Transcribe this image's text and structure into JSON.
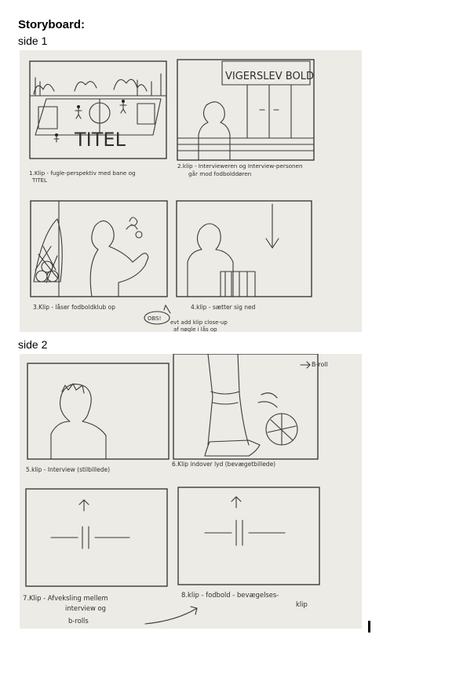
{
  "document": {
    "title": "Storyboard:",
    "sides": [
      {
        "label": "side 1",
        "panels": [
          {
            "caption_line1": "1.Klip - fugle-perspektiv med bane og",
            "caption_line2": "TITEL",
            "drawn_text": "TITEL"
          },
          {
            "caption_line1": "2.klip - Intervieweren og Interview-personen",
            "caption_line2": "går mod fodbolddøren",
            "drawn_text": "VIGERSLEV BOLD"
          },
          {
            "caption_line1": "3.Klip - låser fodboldklub op",
            "caption_line2": ""
          },
          {
            "caption_line1": "4.klip - sætter sig ned",
            "caption_line2": ""
          }
        ],
        "note": {
          "badge": "OBS!",
          "line1": "evt add klip close-up",
          "line2": "af nøgle i lås op"
        }
      },
      {
        "label": "side 2",
        "panels": [
          {
            "caption_line1": "5.klip - Interview (stilbillede)",
            "caption_line2": ""
          },
          {
            "caption_line1": "6.Klip indover lyd (bevægetbillede)",
            "caption_line2": "",
            "drawn_text": "B-roll"
          },
          {
            "caption_line1": "7.Klip - Afveksling mellem",
            "caption_line2": "interview og",
            "caption_line3": "b-rolls"
          },
          {
            "caption_line1": "8.klip - fodbold - bevægelses-",
            "caption_line2": "klip"
          }
        ]
      }
    ]
  }
}
